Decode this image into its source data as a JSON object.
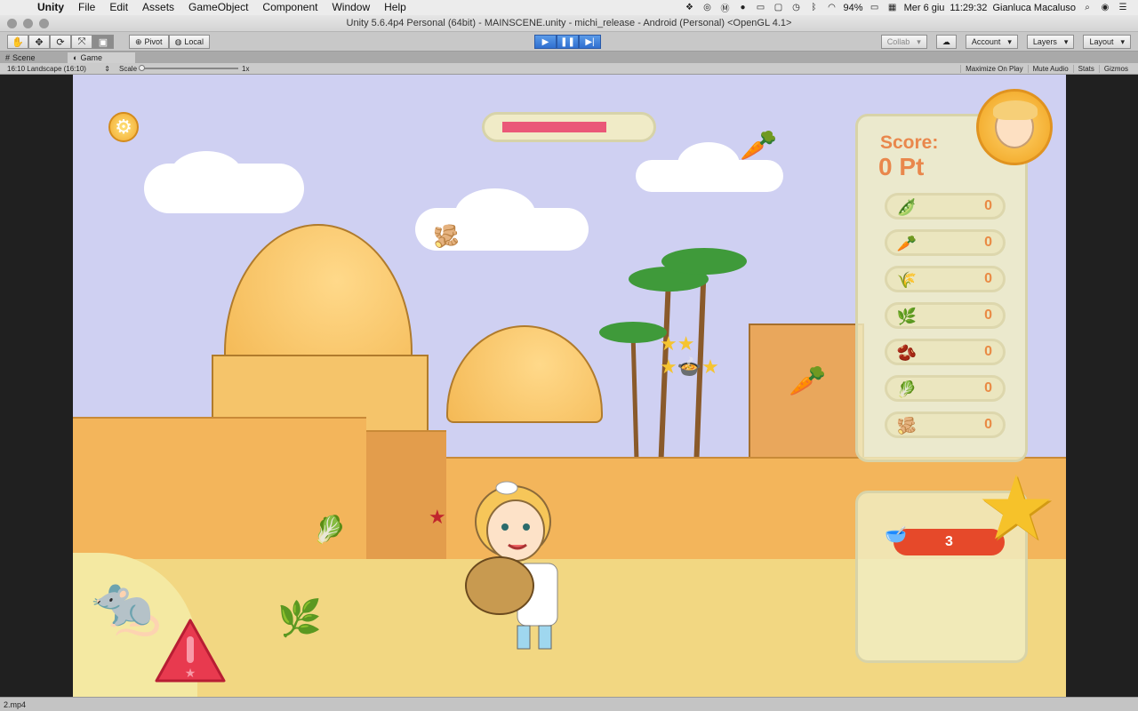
{
  "menubar": {
    "app": "Unity",
    "items": [
      "File",
      "Edit",
      "Assets",
      "GameObject",
      "Component",
      "Window",
      "Help"
    ],
    "battery": "94%",
    "date": "Mer 6 giu",
    "time": "11:29:32",
    "user": "Gianluca Macaluso"
  },
  "window": {
    "title": "Unity 5.6.4p4 Personal (64bit) - MAINSCENE.unity - michi_release - Android (Personal) <OpenGL 4.1>"
  },
  "toolbar": {
    "pivot": "Pivot",
    "local": "Local",
    "collab": "Collab",
    "account": "Account",
    "layers": "Layers",
    "layout": "Layout"
  },
  "tabs": {
    "scene": "Scene",
    "game": "Game"
  },
  "gamebar": {
    "resolution": "16:10 Landscape (16:10)",
    "scale_label": "Scale",
    "scale_value": "1x",
    "maximize": "Maximize On Play",
    "mute": "Mute Audio",
    "stats": "Stats",
    "gizmos": "Gizmos"
  },
  "game": {
    "progress_fraction": 0.78,
    "score_label": "Score:",
    "score_value": "0 Pt",
    "items": [
      {
        "icon": "pepper-icon",
        "count": "0"
      },
      {
        "icon": "carrot-icon",
        "count": "0"
      },
      {
        "icon": "herb-bundle-icon",
        "count": "0"
      },
      {
        "icon": "parsley-icon",
        "count": "0"
      },
      {
        "icon": "seeds-icon",
        "count": "0"
      },
      {
        "icon": "leek-icon",
        "count": "0"
      },
      {
        "icon": "ginger-icon",
        "count": "0"
      }
    ],
    "lives": "3"
  },
  "statusbar": {
    "text": "2.mp4"
  }
}
